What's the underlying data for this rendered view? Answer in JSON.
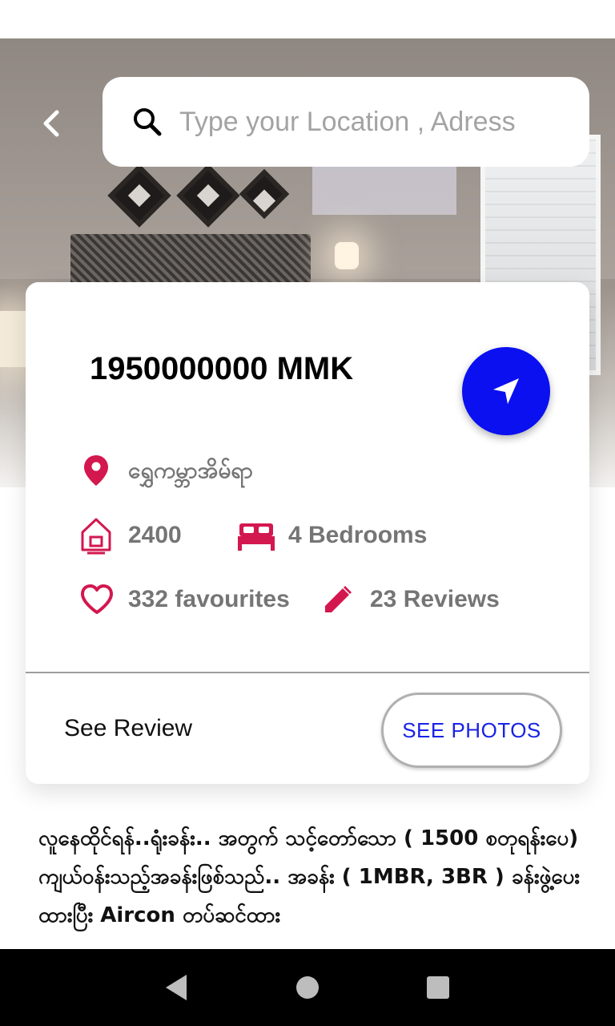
{
  "search": {
    "placeholder": "Type your Location , Adress"
  },
  "listing": {
    "price": "1950000000 MMK",
    "location": "ရွှေကမ္ဘာအိမ်ရာ",
    "area": "2400",
    "bedrooms": "4 Bedrooms",
    "favourites": "332 favourites",
    "reviews": "23 Reviews",
    "see_review_label": "See Review",
    "see_photos_label": "SEE PHOTOS",
    "description": "လူနေထိုင်ရန်..ရုံးခန်း.. အတွက် သင့်တော်သော ( 1500 စတုရန်းပေ) ကျယ်ဝန်းသည့်အခန်းဖြစ်သည်.. အခန်း ( 1MBR, 3BR ) ခန်းဖွဲ့ပေးထားပြီး Aircon တပ်ဆင်ထား"
  },
  "colors": {
    "accent_red": "#d3174f",
    "fab_blue": "#0a10f0",
    "button_text_blue": "#1a22e6"
  },
  "icons": {
    "back": "chevron-left-icon",
    "search": "search-icon",
    "navigate": "navigation-arrow-icon",
    "location": "map-pin-icon",
    "area": "house-icon",
    "bed": "bed-icon",
    "favourite": "heart-outline-icon",
    "review": "pencil-icon"
  }
}
